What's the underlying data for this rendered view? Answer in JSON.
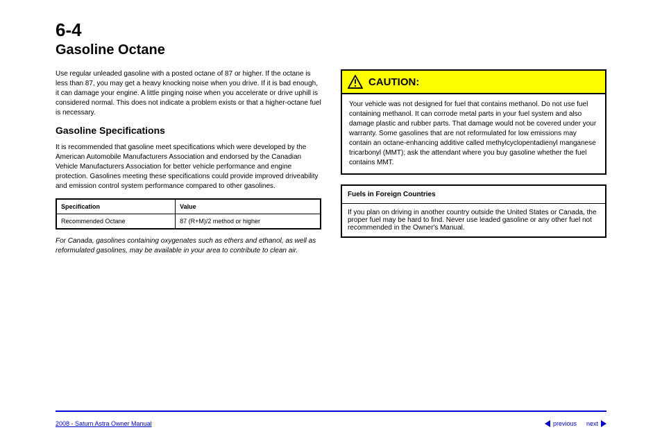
{
  "header": {
    "section_number": "6-4",
    "section_title": "Gasoline Octane"
  },
  "left": {
    "para1": "Use regular unleaded gasoline with a posted octane of 87 or higher. If the octane is less than 87, you may get a heavy knocking noise when you drive. If it is bad enough, it can damage your engine. A little pinging noise when you accelerate or drive uphill is considered normal. This does not indicate a problem exists or that a higher-octane fuel is necessary.",
    "subsection": "Gasoline Specifications",
    "para2": "It is recommended that gasoline meet specifications which were developed by the American Automobile Manufacturers Association and endorsed by the Canadian Vehicle Manufacturers Association for better vehicle performance and engine protection. Gasolines meeting these specifications could provide improved driveability and emission control system performance compared to other gasolines.",
    "table": {
      "headers": [
        "Specification",
        "Value"
      ],
      "row": [
        "Recommended Octane",
        "87 (R+M)/2 method or higher"
      ]
    },
    "note": "For Canada, gasolines containing oxygenates such as ethers and ethanol, as well as reformulated gasolines, may be available in your area to contribute to clean air."
  },
  "right": {
    "caution_label": "CAUTION:",
    "caution_body": "Your vehicle was not designed for fuel that contains methanol. Do not use fuel containing methanol. It can corrode metal parts in your fuel system and also damage plastic and rubber parts. That damage would not be covered under your warranty. Some gasolines that are not reformulated for low emissions may contain an octane-enhancing additive called methylcyclopentadienyl manganese tricarbonyl (MMT); ask the attendant where you buy gasoline whether the fuel contains MMT.",
    "small_table": {
      "header": "Fuels in Foreign Countries",
      "body": "If you plan on driving in another country outside the United States or Canada, the proper fuel may be hard to find. Never use leaded gasoline or any other fuel not recommended in the Owner's Manual."
    }
  },
  "footer": {
    "link_text": "2008 - Saturn Astra Owner Manual",
    "prev": "previous",
    "next": "next"
  }
}
